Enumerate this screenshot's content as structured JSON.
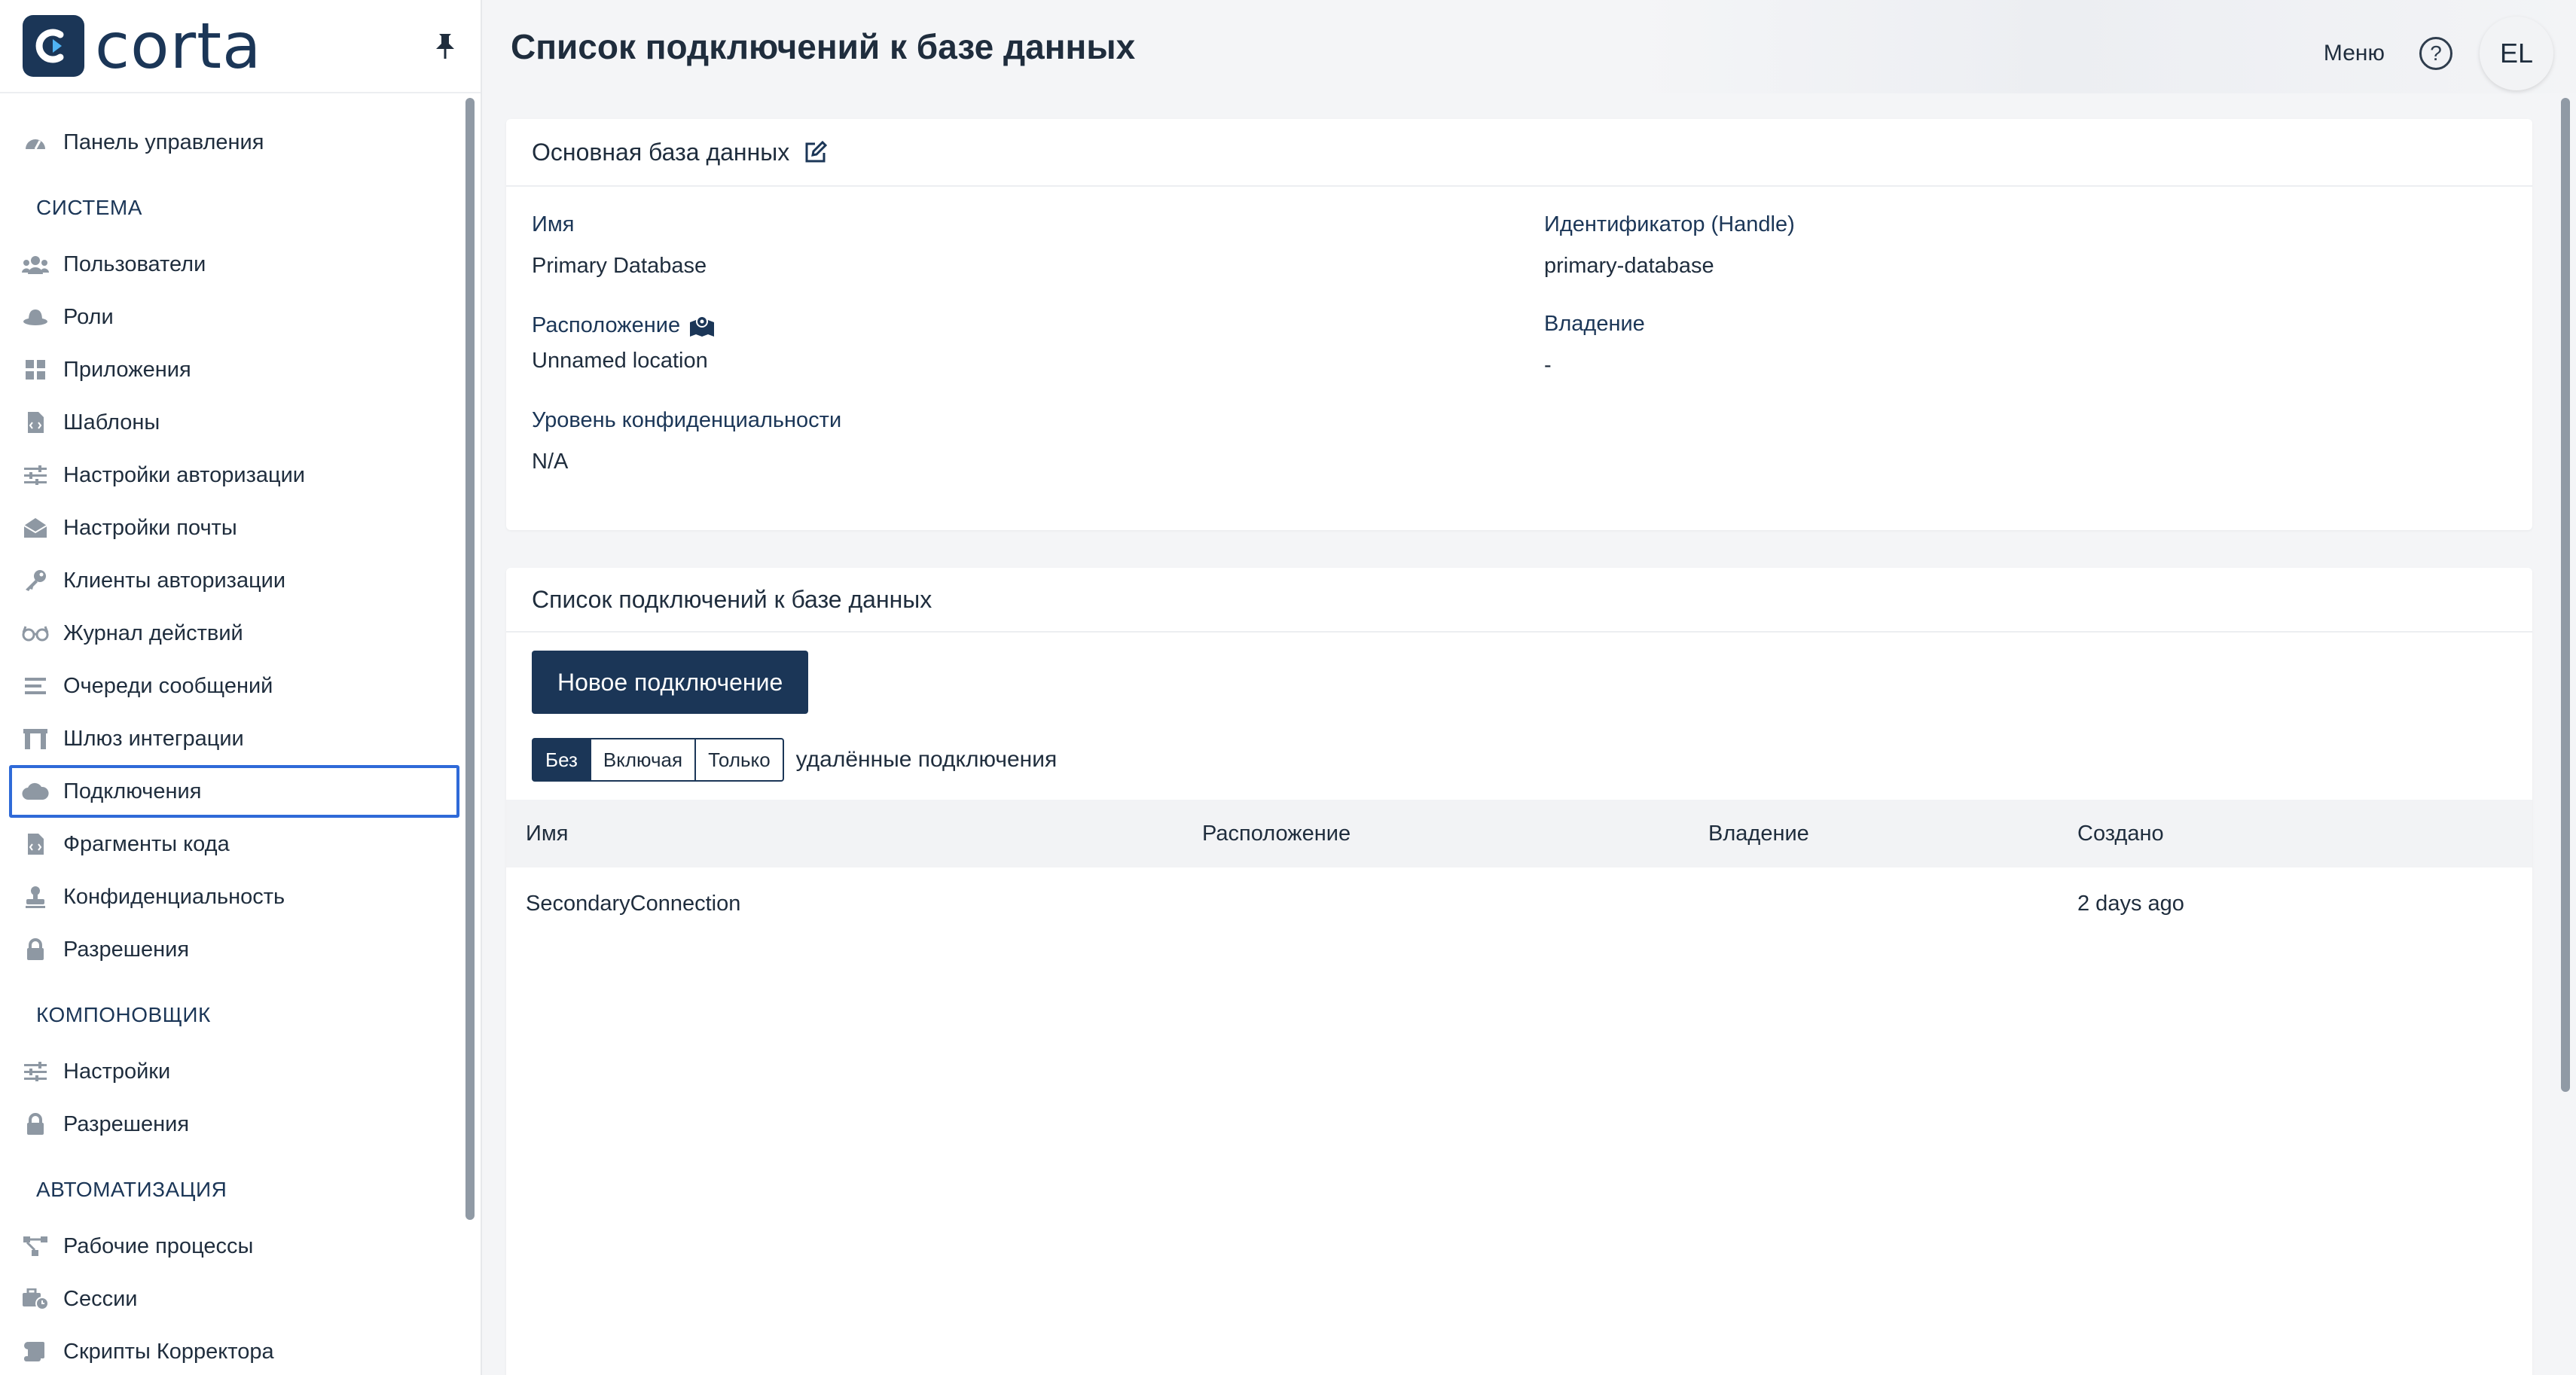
{
  "brand": {
    "name": "corta"
  },
  "sidebar": {
    "top_item": {
      "label": "Панель управления",
      "icon": "dashboard-icon"
    },
    "sections": [
      {
        "title": "СИСТЕМА",
        "items": [
          {
            "label": "Пользователи",
            "icon": "users-icon"
          },
          {
            "label": "Роли",
            "icon": "hat-icon"
          },
          {
            "label": "Приложения",
            "icon": "apps-grid-icon"
          },
          {
            "label": "Шаблоны",
            "icon": "file-code-icon"
          },
          {
            "label": "Настройки авторизации",
            "icon": "sliders-icon"
          },
          {
            "label": "Настройки почты",
            "icon": "envelope-open-icon"
          },
          {
            "label": "Клиенты авторизации",
            "icon": "key-icon"
          },
          {
            "label": "Журнал действий",
            "icon": "glasses-icon"
          },
          {
            "label": "Очереди сообщений",
            "icon": "list-icon"
          },
          {
            "label": "Шлюз интеграции",
            "icon": "gateway-icon"
          },
          {
            "label": "Подключения",
            "icon": "cloud-icon",
            "active": true
          },
          {
            "label": "Фрагменты кода",
            "icon": "file-code-icon"
          },
          {
            "label": "Конфиденциальность",
            "icon": "stamp-icon"
          },
          {
            "label": "Разрешения",
            "icon": "lock-icon"
          }
        ]
      },
      {
        "title": "КОМПОНОВЩИК",
        "items": [
          {
            "label": "Настройки",
            "icon": "sliders-icon"
          },
          {
            "label": "Разрешения",
            "icon": "lock-icon"
          }
        ]
      },
      {
        "title": "АВТОМАТИЗАЦИЯ",
        "items": [
          {
            "label": "Рабочие процессы",
            "icon": "workflow-icon"
          },
          {
            "label": "Сессии",
            "icon": "sessions-icon"
          },
          {
            "label": "Скрипты Корректора",
            "icon": "scroll-icon"
          }
        ]
      }
    ]
  },
  "header": {
    "title": "Список подключений к базе данных",
    "menu_label": "Меню",
    "help_symbol": "?",
    "avatar_initials": "EL"
  },
  "database_card": {
    "title": "Основная база данных",
    "name_label": "Имя",
    "name_value": "Primary Database",
    "handle_label": "Идентификатор (Handle)",
    "handle_value": "primary-database",
    "location_label": "Расположение",
    "location_value": "Unnamed location",
    "ownership_label": "Владение",
    "ownership_value": "-",
    "sensitivity_label": "Уровень конфиденциальности",
    "sensitivity_value": "N/A"
  },
  "connections_card": {
    "title": "Список подключений к базе данных",
    "new_button": "Новое подключение",
    "filter": {
      "options": [
        "Без",
        "Включая",
        "Только"
      ],
      "selected": "Без",
      "suffix": "удалённые подключения"
    },
    "columns": [
      "Имя",
      "Расположение",
      "Владение",
      "Создано"
    ],
    "rows": [
      {
        "name": "SecondaryConnection",
        "location": "",
        "ownership": "",
        "created": "2 days ago"
      }
    ]
  },
  "colors": {
    "brand": "#1b3657",
    "active_border": "#2f6ad8",
    "icon_gray": "#8e98a3"
  }
}
